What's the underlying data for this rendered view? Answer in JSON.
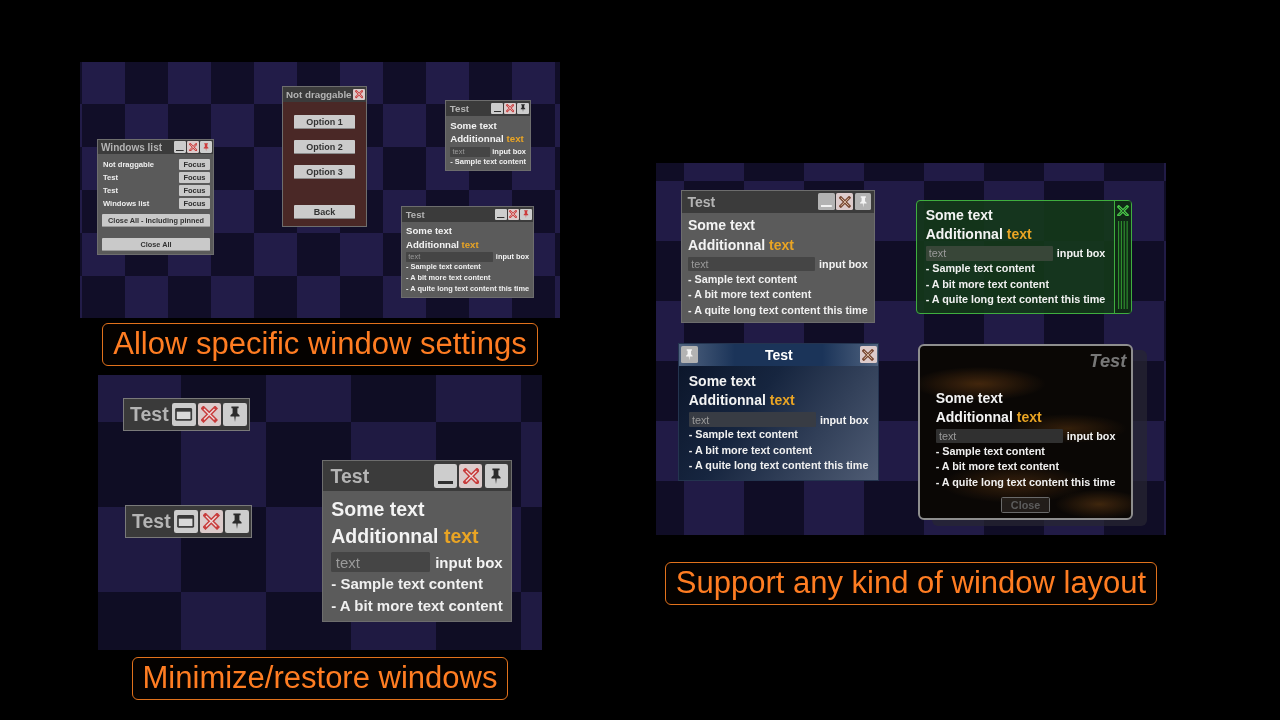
{
  "sections": [
    {
      "windows": [
        {
          "kind": "list",
          "title": "Windows list",
          "minimized": false,
          "active": true,
          "controls": [
            {
              "kind": "minimize"
            },
            {
              "kind": "close"
            },
            {
              "kind": "pin",
              "on": true
            }
          ],
          "rows": [
            {
              "name": "Not draggable",
              "button": "Focus"
            },
            {
              "name": "Test",
              "button": "Focus"
            },
            {
              "name": "Test",
              "button": "Focus"
            },
            {
              "name": "Windows list",
              "button": "Focus"
            }
          ],
          "buttons": [
            "Close All - Including pinned",
            "Close All"
          ]
        },
        {
          "kind": "menu",
          "title": "Not draggable",
          "controls": [
            {
              "kind": "close"
            }
          ],
          "options": [
            "Option 1",
            "Option 2",
            "Option 3"
          ],
          "back": "Back"
        },
        {
          "kind": "basic",
          "title": "Test",
          "minimized": false,
          "active": true,
          "controls": [
            {
              "kind": "minimize"
            },
            {
              "kind": "close"
            },
            {
              "kind": "pin",
              "on": false
            }
          ],
          "heading": "Some text",
          "subheading": "Additionnal",
          "highlight": "text",
          "field": {
            "placeholder": "text",
            "label": "input box"
          },
          "items": [
            "- Sample text content"
          ]
        },
        {
          "kind": "basic",
          "title": "Test",
          "minimized": false,
          "active": true,
          "controls": [
            {
              "kind": "minimize"
            },
            {
              "kind": "close"
            },
            {
              "kind": "pin",
              "on": true
            }
          ],
          "heading": "Some text",
          "subheading": "Additionnal",
          "highlight": "text",
          "field": {
            "placeholder": "text",
            "label": "input box"
          },
          "items": [
            "- Sample text content",
            "- A bit more text content",
            "- A quite long text content this time"
          ]
        }
      ],
      "caption": "Allow specific window settings"
    },
    {
      "windows": [
        {
          "kind": "basic",
          "title": "Test",
          "minimized": true,
          "active": true,
          "controls": [
            {
              "kind": "minimize"
            },
            {
              "kind": "close"
            },
            {
              "kind": "pin",
              "on": false
            }
          ]
        },
        {
          "kind": "basic",
          "title": "Test",
          "minimized": true,
          "active": true,
          "controls": [
            {
              "kind": "minimize"
            },
            {
              "kind": "close"
            },
            {
              "kind": "pin",
              "on": false
            }
          ]
        },
        {
          "kind": "basic",
          "title": "Test",
          "minimized": false,
          "active": true,
          "controls": [
            {
              "kind": "minimize"
            },
            {
              "kind": "close"
            },
            {
              "kind": "pin",
              "on": false
            }
          ],
          "heading": "Some text",
          "subheading": "Additionnal",
          "highlight": "text",
          "field": {
            "placeholder": "text",
            "label": "input box"
          },
          "items": [
            "- Sample text content",
            "- A bit more text content"
          ]
        }
      ],
      "caption": "Minimize/restore windows"
    },
    {
      "windows": [
        {
          "kind": "basic",
          "title": "Test",
          "minimized": false,
          "active": false,
          "controls": [
            {
              "kind": "minimize"
            },
            {
              "kind": "close"
            },
            {
              "kind": "pin",
              "on": false
            }
          ],
          "heading": "Some text",
          "subheading": "Additionnal",
          "highlight": "text",
          "field": {
            "placeholder": "text",
            "label": "input box"
          },
          "items": [
            "- Sample text content",
            "- A bit more text content",
            "- A quite long text content this time"
          ]
        },
        {
          "kind": "sidebar",
          "controls": [
            {
              "kind": "close"
            }
          ],
          "heading": "Some text",
          "subheading": "Additionnal",
          "highlight": "text",
          "field": {
            "placeholder": "text",
            "label": "input box"
          },
          "items": [
            "- Sample text content",
            "- A bit more text content",
            "- A quite long text content this time"
          ]
        },
        {
          "kind": "banner",
          "title": "Test",
          "active": false,
          "controls": [
            {
              "kind": "pin",
              "on": false
            },
            {
              "kind": "close"
            }
          ],
          "heading": "Some text",
          "subheading": "Additionnal",
          "highlight": "text",
          "field": {
            "placeholder": "text",
            "label": "input box"
          },
          "items": [
            "- Sample text content",
            "- A bit more text content",
            "- A quite long text content this time"
          ]
        },
        {
          "kind": "textured",
          "title": "Test",
          "heading": "Some text",
          "subheading": "Additionnal",
          "highlight": "text",
          "field": {
            "placeholder": "text",
            "label": "input box"
          },
          "items": [
            "- Sample text content",
            "- A bit more text content",
            "- A quite long text content this time"
          ],
          "footer": {
            "label": "Close",
            "disabled": true
          }
        }
      ],
      "caption": "Support any kind of window layout"
    }
  ]
}
